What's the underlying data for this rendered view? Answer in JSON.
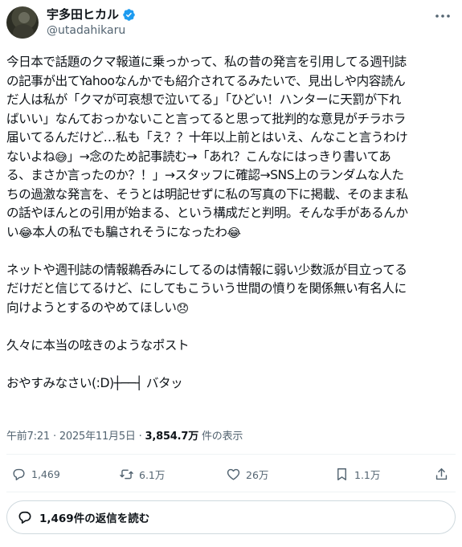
{
  "author": {
    "display_name": "宇多田ヒカル",
    "handle": "@utadahikaru",
    "verified": true
  },
  "post": {
    "lines": [
      "今日本で話題のクマ報道に乗っかって、私の昔の発言を引用してる週刊誌",
      "の記事が出てYahooなんかでも紹介されてるみたいで、見出しや内容読ん",
      "だ人は私が「クマが可哀想で泣いてる」「ひどい！ハンターに天罰が下れ",
      "ばいい」なんておっかないこと言ってると思って批判的な意見がチラホラ",
      "届いてるんだけど…私も「え？？十年以上前とはいえ、んなこと言うわけ",
      "ないよね",
      "」→念のため記事読む→「あれ？こんなにはっきり書いてあ",
      "る、まさか言ったのか？！」→スタッフに確認→SNS上のランダムな人た",
      "ちの過激な発言を、そうとは明記せずに私の写真の下に掲載、そのまま私",
      "の話やほんとの引用が始まる、という構成だと判明。そんな手があるんか",
      "い",
      "本人の私でも騙されそうになったわ",
      "ネットや週刊誌の情報鵜呑みにしてるのは情報に弱い少数派が目立ってる",
      "だけだと信じてるけど、にしてもこういう世間の憤りを関係無い有名人に",
      "向けようとするのやめてほしい",
      "久々に本当の呟きのようなポスト",
      "おやすみなさい(:D)┼──┤ バタッ"
    ],
    "emojis": {
      "sweat_smile": "😅",
      "joy": "😂",
      "disappointed": "😞"
    }
  },
  "meta": {
    "time": "午前7:21",
    "separator": "·",
    "date": "2025年11月5日",
    "views": "3,854.7万",
    "views_label": "件の表示"
  },
  "actions": {
    "replies": "1,469",
    "reposts": "6.1万",
    "likes": "26万",
    "bookmarks": "1.1万"
  },
  "read_replies": "1,469件の返信を読む",
  "colors": {
    "accent": "#1d9bf0",
    "secondary_text": "#536471",
    "primary_text": "#0f1419"
  }
}
